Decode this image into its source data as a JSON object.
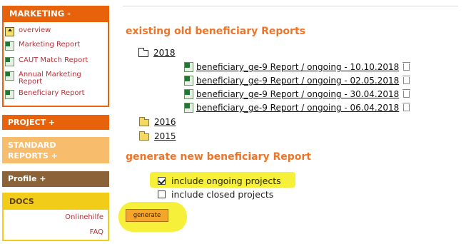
{
  "sidebar": {
    "marketing": {
      "title": "MARKETING -",
      "items": [
        {
          "label": "overview",
          "icon": "folder-up-icon"
        },
        {
          "label": "Marketing Report",
          "icon": "excel-icon"
        },
        {
          "label": "CAUT Match Report",
          "icon": "excel-icon"
        },
        {
          "label": "Annual Marketing Report",
          "icon": "excel-icon"
        },
        {
          "label": "Beneficiary Report",
          "icon": "excel-icon"
        }
      ]
    },
    "project": {
      "title": "PROJECT +"
    },
    "standard_reports": {
      "title_line1": "STANDARD",
      "title_line2": "REPORTS +"
    },
    "profile": {
      "title": "Profile +"
    },
    "docs": {
      "title": "DOCS",
      "links": [
        "Onlinehilfe",
        "FAQ"
      ]
    }
  },
  "main": {
    "existing_title": "existing old beneficiary Reports",
    "folders": [
      {
        "year": "2018",
        "state": "open",
        "reports": [
          "beneficiary_ge-9 Report / ongoing - 10.10.2018",
          "beneficiary_ge-9 Report / ongoing - 02.05.2018",
          "beneficiary_ge-9 Report / ongoing - 30.04.2018",
          "beneficiary_ge-9 Report / ongoing - 06.04.2018"
        ]
      },
      {
        "year": "2016",
        "state": "closed"
      },
      {
        "year": "2015",
        "state": "closed"
      }
    ],
    "generate_title": "generate new beneficiary Report",
    "options": [
      {
        "label": "include ongoing projects",
        "checked": true
      },
      {
        "label": "include closed projects",
        "checked": false
      }
    ],
    "generate_button": "generate"
  },
  "colors": {
    "accent_orange": "#e8620c",
    "heading_orange": "#f07426",
    "standard_reports": "#f7bd6c",
    "profile_brown": "#8c6238",
    "docs_yellow": "#f1cc19",
    "highlight_yellow": "#f6f03a",
    "link_red": "#b5303a"
  }
}
